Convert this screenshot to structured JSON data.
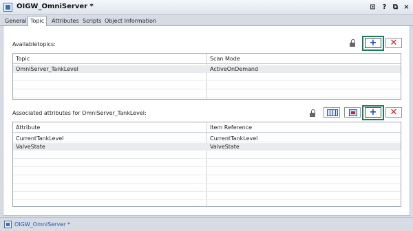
{
  "window": {
    "title": "OIGW_OmniServer *",
    "buttons": {
      "pin": "⧉",
      "help": "?",
      "restore": "⧉",
      "close": "×"
    }
  },
  "tabs": [
    "General",
    "Topic",
    "Attributes",
    "Scripts",
    "Object Information"
  ],
  "active_tab": "Topic",
  "topics": {
    "label": "Availabletopics:",
    "columns": [
      "Topic",
      "Scan Mode"
    ],
    "rows": [
      [
        "OmniServer_TankLevel",
        "ActiveOnDemand"
      ]
    ],
    "add_label": "+",
    "delete_label": "✕"
  },
  "attributes": {
    "label": "Associated attributes for OmniServer_TankLevel:",
    "columns": [
      "Attribute",
      "Item Reference"
    ],
    "rows": [
      [
        "CurrentTankLevel",
        "CurrentTankLevel"
      ],
      [
        "ValveState",
        "ValveState"
      ]
    ],
    "add_label": "+",
    "delete_label": "✕"
  },
  "status": {
    "text": "OIGW_OmniServer *"
  },
  "colors": {
    "highlight": "#1c7a5a",
    "add": "#1e3ca8",
    "delete": "#d01818",
    "link": "#2456a8"
  }
}
